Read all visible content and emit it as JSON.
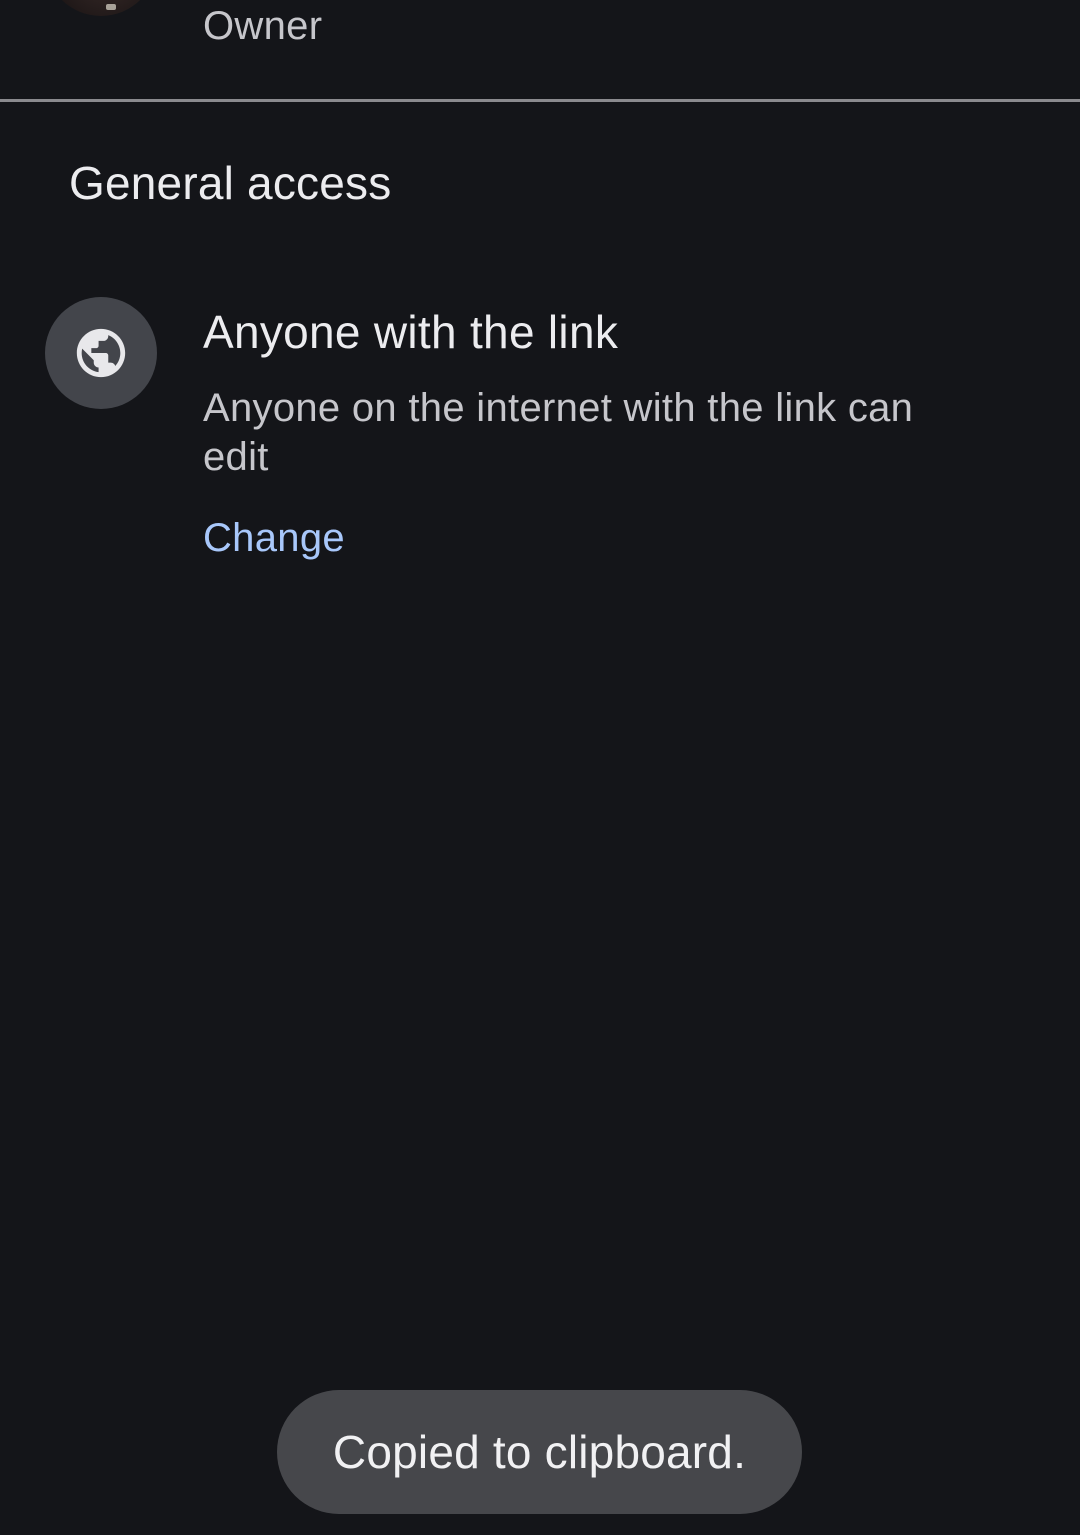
{
  "owner": {
    "role": "Owner"
  },
  "general_access": {
    "heading": "General access",
    "icon": "globe-icon",
    "title": "Anyone with the link",
    "description": "Anyone on the internet with the link can edit",
    "change_label": "Change"
  },
  "toast": {
    "message": "Copied to clipboard."
  },
  "colors": {
    "background": "#141519",
    "icon_circle": "#43454b",
    "link": "#a8c7fa",
    "toast": "#46474b",
    "divider": "#8a8a8e"
  }
}
